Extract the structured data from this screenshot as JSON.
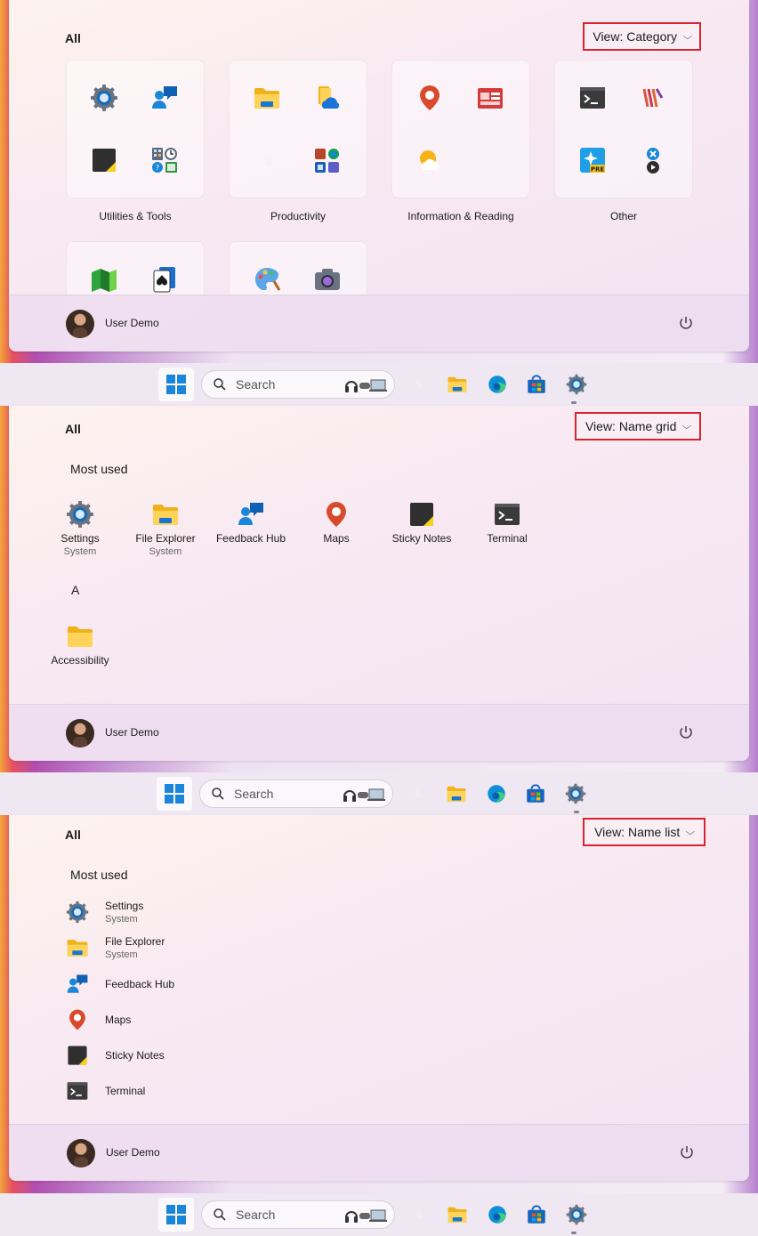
{
  "colors": {
    "highlight_border": "#d7242f",
    "accent_blue": "#0f6cbd"
  },
  "panels": {
    "category": {
      "all_label": "All",
      "view_label": "View: Category",
      "categories": [
        {
          "label": "Utilities & Tools",
          "icons": [
            "settings-icon",
            "feedback-hub-icon",
            "sticky-notes-icon",
            "windows-tools-icon"
          ]
        },
        {
          "label": "Productivity",
          "icons": [
            "file-explorer-icon",
            "onedrive-icon",
            "copilot-icon",
            "office-apps-icon"
          ]
        },
        {
          "label": "Information & Reading",
          "icons": [
            "maps-icon",
            "news-icon",
            "weather-icon"
          ]
        },
        {
          "label": "Other",
          "icons": [
            "terminal-icon",
            "app-icon",
            "pre-app-icon",
            "media-app-icon"
          ]
        }
      ],
      "partial_categories": [
        {
          "icons": [
            "game-blocks-icon",
            "solitaire-icon"
          ]
        },
        {
          "icons": [
            "paint-icon",
            "camera-icon"
          ]
        }
      ],
      "user_name": "User Demo"
    },
    "grid": {
      "all_label": "All",
      "view_label": "View: Name grid",
      "most_used_label": "Most used",
      "apps": [
        {
          "name": "Settings",
          "sub": "System",
          "icon": "settings-icon"
        },
        {
          "name": "File Explorer",
          "sub": "System",
          "icon": "file-explorer-icon"
        },
        {
          "name": "Feedback Hub",
          "sub": "",
          "icon": "feedback-hub-icon"
        },
        {
          "name": "Maps",
          "sub": "",
          "icon": "maps-icon"
        },
        {
          "name": "Sticky Notes",
          "sub": "",
          "icon": "sticky-notes-icon"
        },
        {
          "name": "Terminal",
          "sub": "",
          "icon": "terminal-icon"
        }
      ],
      "letter_a": "A",
      "a_apps": [
        {
          "name": "Accessibility",
          "icon": "folder-icon"
        }
      ],
      "user_name": "User Demo"
    },
    "list": {
      "all_label": "All",
      "view_label": "View: Name list",
      "most_used_label": "Most used",
      "apps": [
        {
          "name": "Settings",
          "sub": "System",
          "icon": "settings-icon"
        },
        {
          "name": "File Explorer",
          "sub": "System",
          "icon": "file-explorer-icon"
        },
        {
          "name": "Feedback Hub",
          "sub": "",
          "icon": "feedback-hub-icon"
        },
        {
          "name": "Maps",
          "sub": "",
          "icon": "maps-icon"
        },
        {
          "name": "Sticky Notes",
          "sub": "",
          "icon": "sticky-notes-icon"
        },
        {
          "name": "Terminal",
          "sub": "",
          "icon": "terminal-icon"
        }
      ],
      "user_name": "User Demo"
    }
  },
  "taskbar": {
    "search_placeholder": "Search",
    "pinned": [
      "copilot-icon",
      "file-explorer-icon",
      "edge-icon",
      "store-icon",
      "settings-icon"
    ]
  }
}
